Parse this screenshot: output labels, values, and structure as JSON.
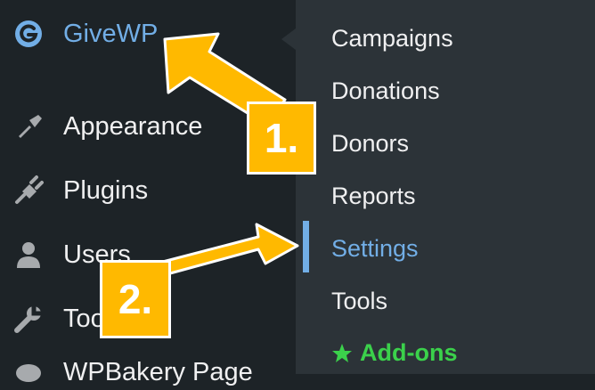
{
  "sidebar": {
    "items": [
      {
        "label": "GiveWP",
        "icon": "givewp-logo-icon"
      },
      {
        "label": "Appearance",
        "icon": "paintbrush-icon"
      },
      {
        "label": "Plugins",
        "icon": "plug-icon"
      },
      {
        "label": "Users",
        "icon": "user-icon"
      },
      {
        "label": "Tools",
        "icon": "wrench-icon"
      },
      {
        "label": "WPBakery Page",
        "icon": "wpbakery-icon"
      }
    ]
  },
  "submenu": {
    "items": [
      {
        "label": "Campaigns"
      },
      {
        "label": "Donations"
      },
      {
        "label": "Donors"
      },
      {
        "label": "Reports"
      },
      {
        "label": "Settings",
        "active": true
      },
      {
        "label": "Tools"
      },
      {
        "label": "Add-ons",
        "icon": "star-icon"
      }
    ]
  },
  "annotations": {
    "step1": "1.",
    "step2": "2."
  },
  "colors": {
    "sidebar_bg": "#1d2327",
    "submenu_bg": "#2c3338",
    "link_blue": "#72aee6",
    "addon_green": "#3bd14b",
    "annotation_yellow": "#ffb900"
  }
}
